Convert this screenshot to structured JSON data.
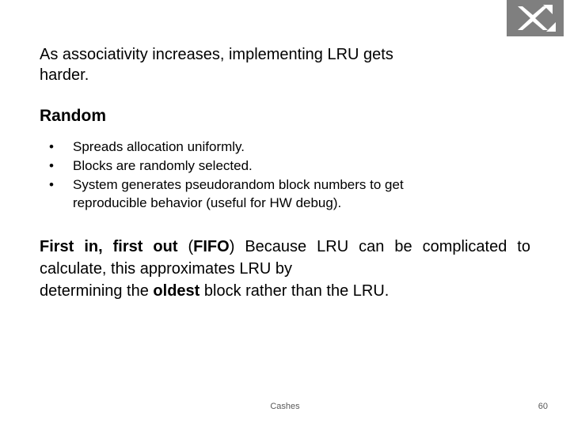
{
  "slide": {
    "intro": {
      "line1": "As associativity increases, implementing LRU gets",
      "line2": "harder."
    },
    "heading_random": "Random",
    "bullets": [
      {
        "marker": "•",
        "line1": "Spreads allocation uniformly.",
        "line2": ""
      },
      {
        "marker": "•",
        "line1": "Blocks are randomly selected.",
        "line2": ""
      },
      {
        "marker": "•",
        "line1": "System generates pseudorandom block numbers to get",
        "line2": "reproducible behavior (useful for HW debug)."
      }
    ],
    "fifo": {
      "bold1": "First in, first out",
      "mid1": " (",
      "bold2": "FIFO",
      "mid2": ") Because LRU can be",
      "line2": "complicated to calculate, this approximates LRU by",
      "line3a": "determining the ",
      "bold3": "oldest",
      "line3b": " block rather than the LRU."
    },
    "footer": {
      "center": "Cashes",
      "page": "60"
    },
    "logo": {
      "name": "university-logo",
      "background": "#7f7f7f",
      "mark_color": "#ffffff"
    }
  }
}
